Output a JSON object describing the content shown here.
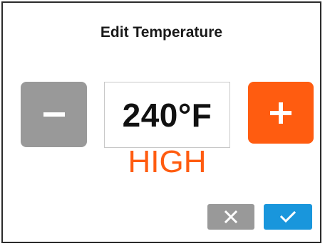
{
  "dialog": {
    "title": "Edit Temperature",
    "temperature": "240°F",
    "level": "HIGH"
  },
  "buttons": {
    "decrease_icon": "minus-icon",
    "increase_icon": "plus-icon",
    "cancel_icon": "close-icon",
    "confirm_icon": "checkmark-icon"
  },
  "colors": {
    "accent": "#ff5c10",
    "neutral_button": "#999999",
    "confirm": "#1996dc"
  }
}
